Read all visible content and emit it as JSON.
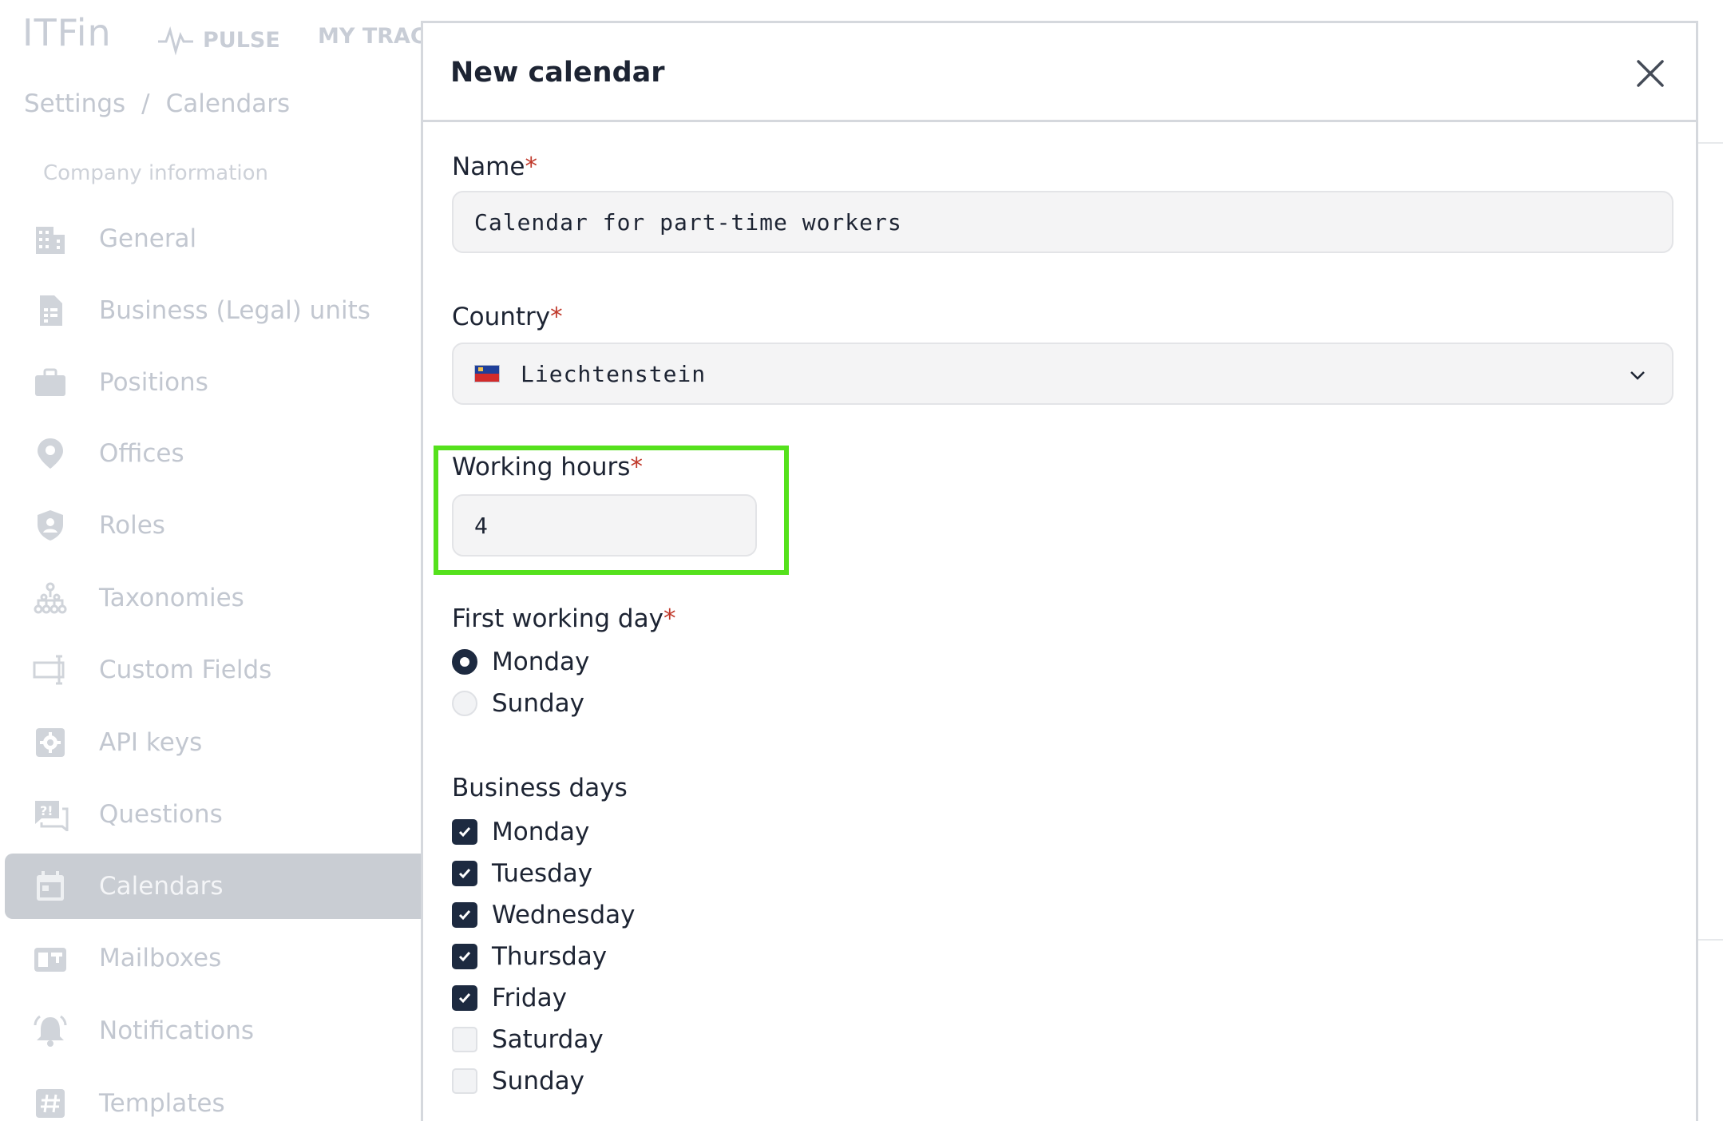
{
  "app": {
    "logo": "ITFin",
    "nav": [
      {
        "label": "PULSE",
        "icon": "pulse-icon"
      },
      {
        "label": "MY TRACKE",
        "icon": ""
      }
    ],
    "breadcrumb": [
      "Settings",
      "/",
      "Calendars"
    ]
  },
  "sidebar": {
    "section_title": "Company information",
    "items": [
      {
        "label": "General",
        "icon": "building-icon",
        "active": false
      },
      {
        "label": "Business (Legal) units",
        "icon": "document-icon",
        "active": false
      },
      {
        "label": "Positions",
        "icon": "briefcase-icon",
        "active": false
      },
      {
        "label": "Offices",
        "icon": "location-pin-icon",
        "active": false
      },
      {
        "label": "Roles",
        "icon": "shield-user-icon",
        "active": false
      },
      {
        "label": "Taxonomies",
        "icon": "hierarchy-icon",
        "active": false
      },
      {
        "label": "Custom Fields",
        "icon": "custom-field-icon",
        "active": false
      },
      {
        "label": "API keys",
        "icon": "gear-key-icon",
        "active": false
      },
      {
        "label": "Questions",
        "icon": "question-chat-icon",
        "active": false
      },
      {
        "label": "Calendars",
        "icon": "calendar-icon",
        "active": true
      },
      {
        "label": "Mailboxes",
        "icon": "mailbox-icon",
        "active": false
      },
      {
        "label": "Notifications",
        "icon": "bell-icon",
        "active": false
      },
      {
        "label": "Templates",
        "icon": "hash-icon",
        "active": false
      }
    ]
  },
  "modal": {
    "title": "New calendar",
    "name": {
      "label": "Name",
      "required_mark": "*",
      "value": "Calendar for part-time workers"
    },
    "country": {
      "label": "Country",
      "required_mark": "*",
      "value": "Liechtenstein",
      "flag": "liechtenstein-flag"
    },
    "working_hours": {
      "label": "Working hours",
      "required_mark": "*",
      "value": "4",
      "highlight_color": "#55e11c"
    },
    "first_working_day": {
      "label": "First working day",
      "required_mark": "*",
      "options": [
        {
          "label": "Monday",
          "selected": true
        },
        {
          "label": "Sunday",
          "selected": false
        }
      ]
    },
    "business_days": {
      "label": "Business days",
      "days": [
        {
          "label": "Monday",
          "checked": true
        },
        {
          "label": "Tuesday",
          "checked": true
        },
        {
          "label": "Wednesday",
          "checked": true
        },
        {
          "label": "Thursday",
          "checked": true
        },
        {
          "label": "Friday",
          "checked": true
        },
        {
          "label": "Saturday",
          "checked": false
        },
        {
          "label": "Sunday",
          "checked": false
        }
      ]
    }
  },
  "colors": {
    "accent": "#1d2a40",
    "required": "#c0392b",
    "highlight": "#55e11c"
  }
}
